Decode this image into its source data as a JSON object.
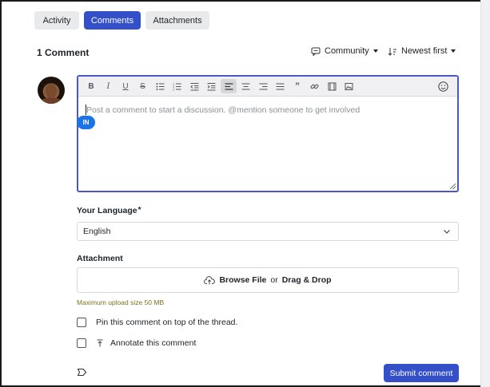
{
  "tabs": [
    {
      "label": "Activity"
    },
    {
      "label": "Comments"
    },
    {
      "label": "Attachments"
    }
  ],
  "header": {
    "count_label": "1 Comment",
    "visibility_label": "Community",
    "sort_label": "Newest first"
  },
  "editor": {
    "placeholder": "Post a comment to start a discussion. @mention someone to get involved",
    "badge": "IN",
    "toolbar_icons": [
      "bold-icon",
      "italic-icon",
      "underline-icon",
      "strikethrough-icon",
      "bullet-list-icon",
      "numbered-list-icon",
      "outdent-icon",
      "indent-icon",
      "align-left-icon",
      "align-center-icon",
      "align-right-icon",
      "align-justify-icon",
      "quote-icon",
      "link-icon",
      "video-icon",
      "image-icon",
      "emoji-icon"
    ]
  },
  "language": {
    "label": "Your Language",
    "required_mark": "*",
    "selected": "English"
  },
  "attachment": {
    "label": "Attachment",
    "browse": "Browse File",
    "or": "or",
    "drag": "Drag & Drop",
    "hint": "Maximum upload size 50 MB"
  },
  "options": {
    "pin": "Pin this comment on top of the thread.",
    "annotate": "Annotate this comment"
  },
  "submit_label": "Submit comment",
  "colors": {
    "accent": "#3450c9",
    "badge": "#1a73e8",
    "hint": "#7a7320"
  }
}
